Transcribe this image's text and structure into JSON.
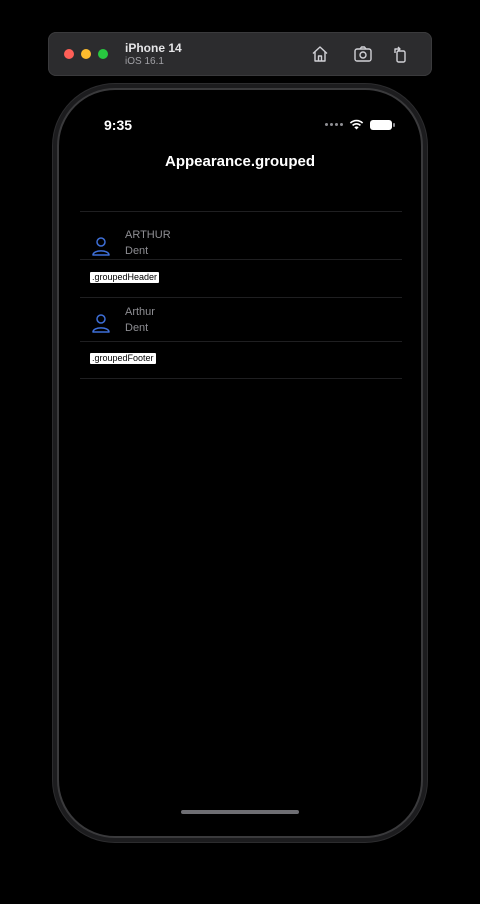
{
  "simulator": {
    "device_name": "iPhone 14",
    "os_version": "iOS 16.1",
    "toolbar_icons": [
      "home-icon",
      "screenshot-icon",
      "rotate-icon"
    ]
  },
  "status_bar": {
    "time": "9:35",
    "icons": [
      "cellular-icon",
      "wifi-icon",
      "battery-icon"
    ]
  },
  "nav": {
    "title": "Appearance.grouped"
  },
  "rows": [
    {
      "icon": "person-icon",
      "title": "ARTHUR",
      "subtitle": "Dent"
    },
    {
      "icon": "person-icon",
      "title": "Arthur",
      "subtitle": "Dent"
    }
  ],
  "labels": {
    "header": ".groupedHeader",
    "footer": ".groupedFooter"
  },
  "colors": {
    "accent": "#3e6fd8",
    "background": "#000000",
    "label_secondary": "#8e8e93"
  }
}
